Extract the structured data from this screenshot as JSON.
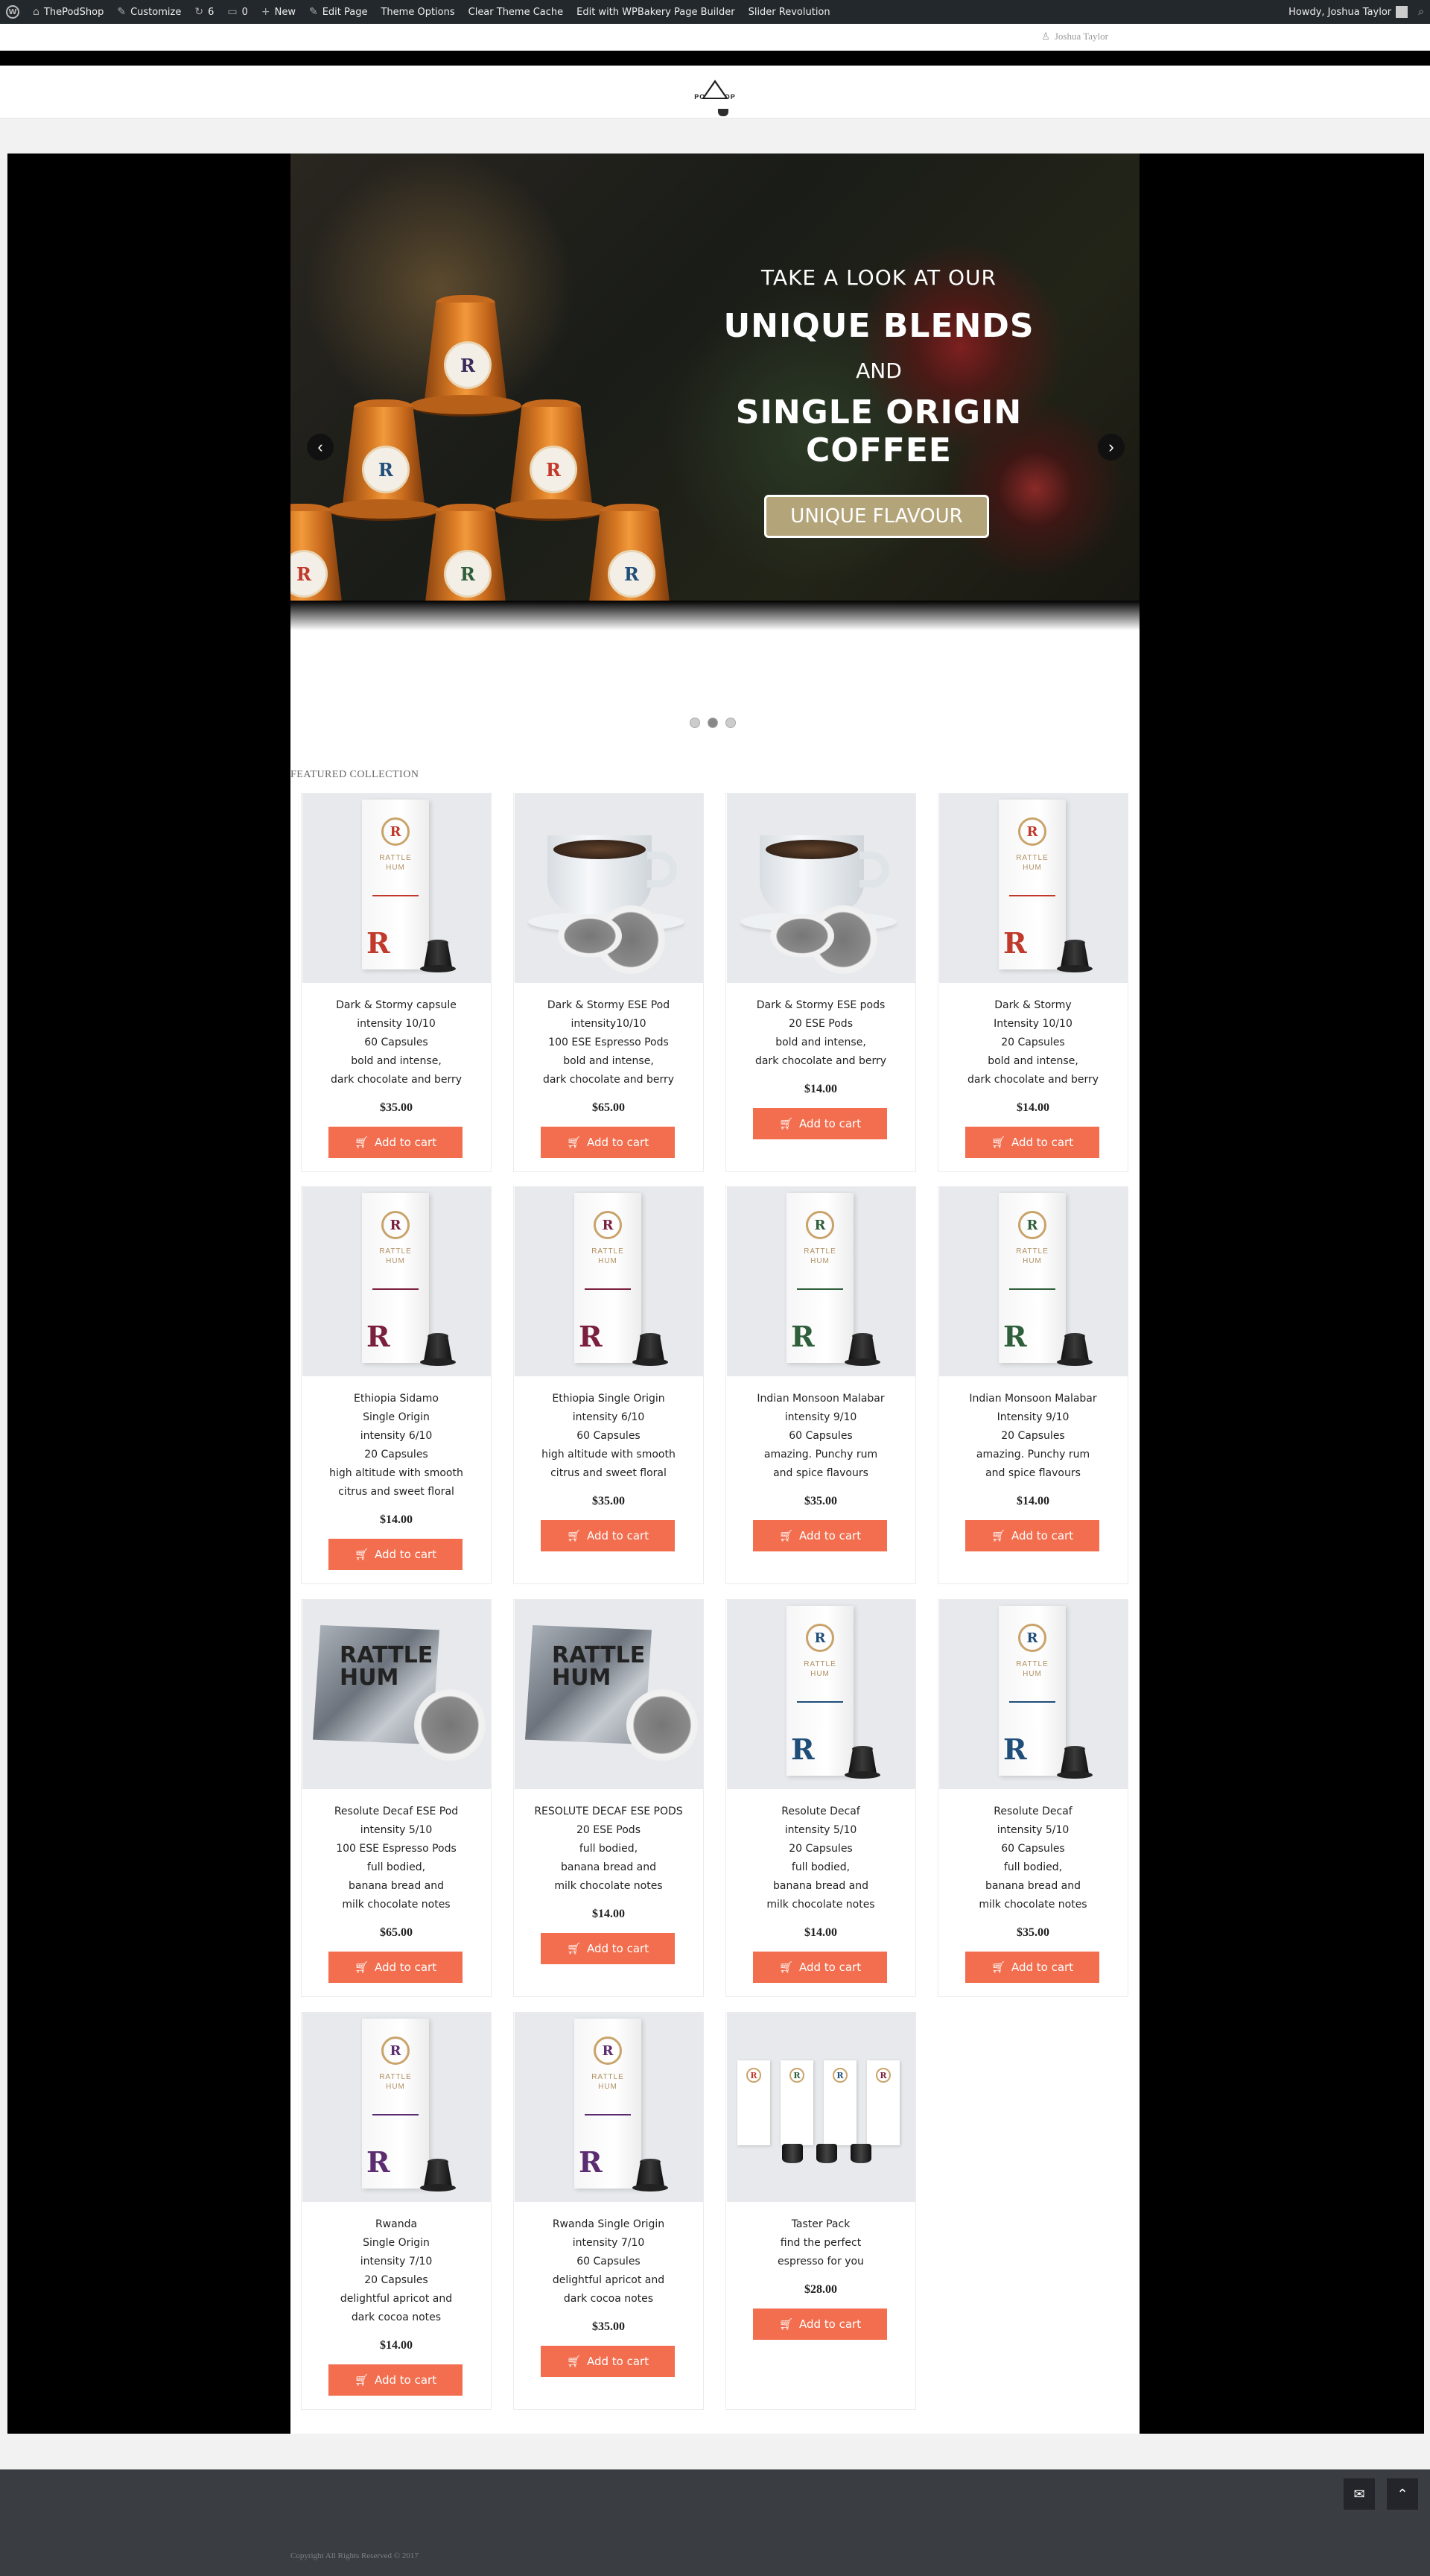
{
  "admin_bar": {
    "wp_logo": "wordpress-icon",
    "site_name": "ThePodShop",
    "customize": "Customize",
    "updates_count": "6",
    "comments_count": "0",
    "new": "New",
    "edit_page": "Edit Page",
    "theme_options": "Theme Options",
    "clear_cache": "Clear Theme Cache",
    "wpbakery": "Edit with WPBakery Page Builder",
    "slider_revolution": "Slider Revolution",
    "howdy": "Howdy, Joshua Taylor"
  },
  "topbar": {
    "user_name": "Joshua Taylor"
  },
  "header": {
    "logo_text": "POD SHOP"
  },
  "slider": {
    "line1": "TAKE A LOOK AT OUR",
    "line2": "UNIQUE BLENDS",
    "line3": "AND",
    "line4": "SINGLE ORIGIN COFFEE",
    "button": "UNIQUE FLAVOUR",
    "prev_icon": "chevron-left-icon",
    "next_icon": "chevron-right-icon",
    "active_dot": 2,
    "dot_count": 3
  },
  "featured_title": "FEATURED COLLECTION",
  "cart_label": "Add to cart",
  "products": [
    {
      "lines": [
        "Dark & Stormy capsule",
        "intensity 10/10",
        "60 Capsules",
        "bold and intense,",
        "dark chocolate and berry"
      ],
      "price": "$35.00",
      "art": "box",
      "accent": "#c0392b"
    },
    {
      "lines": [
        "Dark & Stormy ESE Pod",
        "intensity10/10",
        "100 ESE Espresso Pods",
        "bold and intense,",
        "dark chocolate and berry"
      ],
      "price": "$65.00",
      "art": "cup"
    },
    {
      "lines": [
        "Dark & Stormy ESE pods",
        "20 ESE Pods",
        "bold and intense,",
        "dark chocolate and berry"
      ],
      "price": "$14.00",
      "art": "cup"
    },
    {
      "lines": [
        "Dark & Stormy",
        "Intensity 10/10",
        "20 Capsules",
        "bold and intense,",
        "dark chocolate and berry"
      ],
      "price": "$14.00",
      "art": "box",
      "accent": "#c0392b"
    },
    {
      "lines": [
        "Ethiopia Sidamo",
        "Single Origin",
        "intensity 6/10",
        "20 Capsules",
        "high altitude with smooth",
        "citrus and sweet floral"
      ],
      "price": "$14.00",
      "art": "box",
      "accent": "#7a1f3d"
    },
    {
      "lines": [
        "Ethiopia Single Origin",
        "intensity 6/10",
        "60 Capsules",
        "high altitude with smooth",
        "citrus and sweet floral"
      ],
      "price": "$35.00",
      "art": "box",
      "accent": "#7a1f3d"
    },
    {
      "lines": [
        "Indian Monsoon Malabar",
        "intensity 9/10",
        "60 Capsules",
        "amazing. Punchy rum",
        "and spice flavours"
      ],
      "price": "$35.00",
      "art": "box",
      "accent": "#2e5e3a"
    },
    {
      "lines": [
        "Indian Monsoon Malabar",
        "Intensity 9/10",
        "20 Capsules",
        "amazing. Punchy rum",
        "and spice flavours"
      ],
      "price": "$14.00",
      "art": "box",
      "accent": "#2e5e3a"
    },
    {
      "lines": [
        "Resolute Decaf ESE Pod",
        "intensity 5/10",
        "100 ESE Espresso Pods",
        "full bodied,",
        "banana bread and",
        "milk chocolate notes"
      ],
      "price": "$65.00",
      "art": "pack"
    },
    {
      "lines": [
        "RESOLUTE DECAF ESE PODS",
        "20 ESE Pods",
        "full bodied,",
        "banana bread and",
        "milk chocolate notes"
      ],
      "price": "$14.00",
      "art": "pack"
    },
    {
      "lines": [
        "Resolute Decaf",
        "intensity 5/10",
        "20 Capsules",
        "full bodied,",
        "banana bread and",
        "milk chocolate notes"
      ],
      "price": "$14.00",
      "art": "box",
      "accent": "#1f4e79"
    },
    {
      "lines": [
        "Resolute Decaf",
        "intensity 5/10",
        "60 Capsules",
        "full bodied,",
        "banana bread and",
        "milk chocolate notes"
      ],
      "price": "$35.00",
      "art": "box",
      "accent": "#1f4e79"
    },
    {
      "lines": [
        "Rwanda",
        "Single Origin",
        "intensity 7/10",
        "20 Capsules",
        "delightful apricot and",
        "dark cocoa notes"
      ],
      "price": "$14.00",
      "art": "box",
      "accent": "#5b2c6f"
    },
    {
      "lines": [
        "Rwanda Single Origin",
        "intensity 7/10",
        "60 Capsules",
        "delightful apricot and",
        "dark cocoa notes"
      ],
      "price": "$35.00",
      "art": "box",
      "accent": "#5b2c6f"
    },
    {
      "lines": [
        "Taster Pack",
        "find the perfect",
        "espresso for you"
      ],
      "price": "$28.00",
      "art": "taster"
    }
  ],
  "box_brand": "RATTLE\nHUM",
  "pack_brand": "RATTLE\nHUM",
  "footer": {
    "copyright": "Copyright All Rights Reserved © 2017",
    "mail_icon": "envelope-icon",
    "top_icon": "chevron-up-icon"
  },
  "colors": {
    "accent_button": "#f26e4e",
    "slider_button": "#b3a47a",
    "admin_bar": "#23282d",
    "footer": "#3a3d42"
  }
}
